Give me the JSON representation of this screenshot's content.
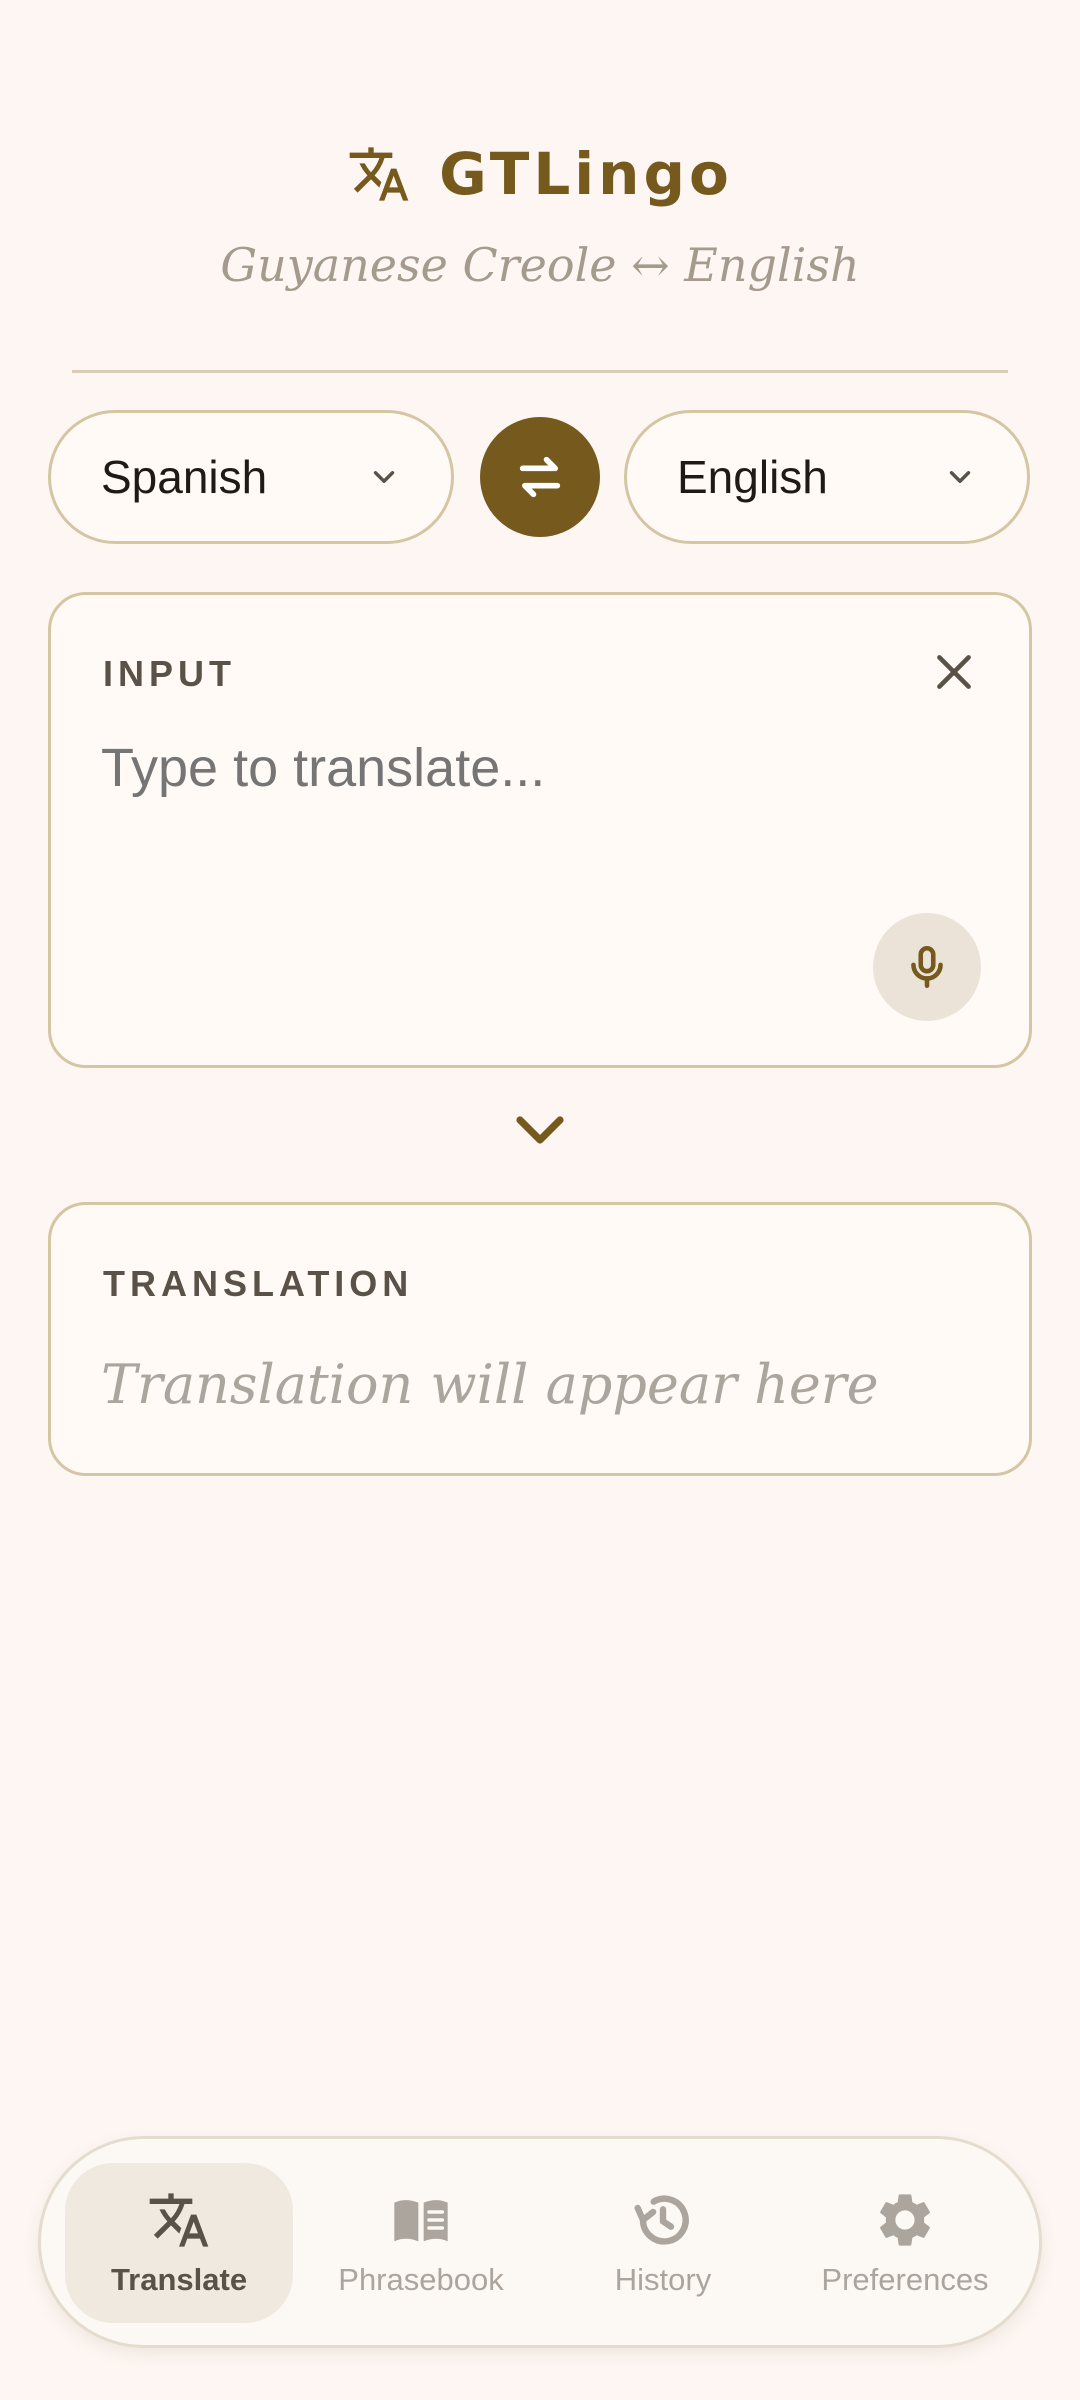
{
  "app": {
    "title": "GTLingo",
    "subtitle": "Guyanese Creole ↔ English"
  },
  "languages": {
    "source": "Spanish",
    "target": "English"
  },
  "input": {
    "label": "INPUT",
    "placeholder": "Type to translate...",
    "value": ""
  },
  "output": {
    "label": "TRANSLATION",
    "placeholder": "Translation will appear here"
  },
  "nav": {
    "items": [
      {
        "label": "Translate",
        "icon": "translate-icon",
        "active": true
      },
      {
        "label": "Phrasebook",
        "icon": "book-icon",
        "active": false
      },
      {
        "label": "History",
        "icon": "history-icon",
        "active": false
      },
      {
        "label": "Preferences",
        "icon": "gear-icon",
        "active": false
      }
    ]
  },
  "colors": {
    "background": "#fdf6f2",
    "accent": "#765a1d",
    "border": "#d4c6a2",
    "muted_text": "#aca59d"
  }
}
